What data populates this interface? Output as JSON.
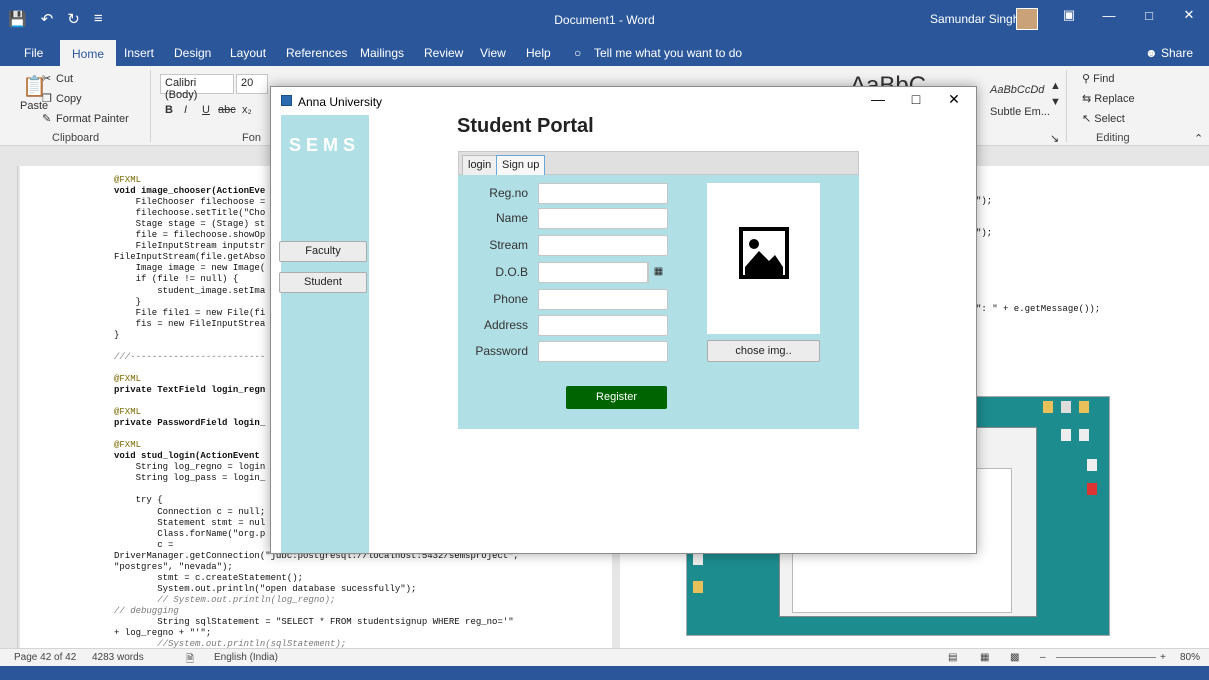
{
  "word": {
    "doc_title": "Document1  -  Word",
    "user": "Samundar Singh",
    "tabs": [
      "File",
      "Home",
      "Insert",
      "Design",
      "Layout",
      "References",
      "Mailings",
      "Review",
      "View",
      "Help"
    ],
    "tell_me": "Tell me what you want to do",
    "share": "Share",
    "clipboard": {
      "paste": "Paste",
      "cut": "Cut",
      "copy": "Copy",
      "format_painter": "Format Painter",
      "group_label": "Clipboard"
    },
    "font": {
      "name": "Calibri (Body)",
      "size": "20",
      "group_label": "Fon"
    },
    "styles": {
      "preview_big": "AaBbC",
      "preview_right": "AaBbCcDd",
      "subtle": "Subtle Em..."
    },
    "editing": {
      "find": "Find",
      "replace": "Replace",
      "select": "Select",
      "group_label": "Editing"
    },
    "status": {
      "page": "Page 42 of 42",
      "words": "4283 words",
      "language": "English (India)",
      "zoom": "80%"
    }
  },
  "code_lines": [
    "@FXML",
    "void image_chooser(ActionEve",
    "    FileChooser filechoose =",
    "    filechoose.setTitle(\"Cho",
    "    Stage stage = (Stage) st",
    "    file = filechoose.showOp",
    "    FileInputStream inputstr",
    "FileInputStream(file.getAbso",
    "    Image image = new Image(",
    "    if (file != null) {",
    "        student_image.setIma",
    "    }",
    "    File file1 = new File(fi",
    "    fis = new FileInputStrea",
    "}",
    "",
    "///-------------------------",
    "",
    "@FXML",
    "private TextField login_regn",
    "",
    "@FXML",
    "private PasswordField login_",
    "",
    "@FXML",
    "void stud_login(ActionEvent",
    "    String log_regno = login",
    "    String log_pass = login_",
    "",
    "    try {",
    "        Connection c = null;",
    "        Statement stmt = nul",
    "        Class.forName(\"org.p",
    "        c =",
    "DriverManager.getConnection(\"jdbc:postgresql://localhost:5432/semsproject\",",
    "\"postgres\", \"nevada\");",
    "        stmt = c.createStatement();",
    "        System.out.println(\"open database sucessfully\");",
    "        // System.out.println(log_regno);",
    "// debugging",
    "        String sqlStatement = \"SELECT * FROM studentsignup WHERE reg_no='\"",
    "+ log_regno + \"'\";",
    "        //System.out.println(sqlStatement);"
  ],
  "page2_fragments": [
    "\");",
    "\");",
    "\": \" + e.getMessage());"
  ],
  "dialog": {
    "title": "Anna University",
    "brand": "SEMS",
    "sidebar_buttons": [
      "Faculty",
      "Student"
    ],
    "portal_title": "Student Portal",
    "tabs": [
      "login",
      "Sign up"
    ],
    "fields": [
      {
        "label": "Reg.no",
        "value": ""
      },
      {
        "label": "Name",
        "value": ""
      },
      {
        "label": "Stream",
        "value": ""
      },
      {
        "label": "D.O.B",
        "value": ""
      },
      {
        "label": "Phone",
        "value": ""
      },
      {
        "label": "Address",
        "value": ""
      },
      {
        "label": "Password",
        "value": ""
      }
    ],
    "register_label": "Register",
    "chose_img_label": "chose img..",
    "colors": {
      "panel": "#b0dfe6",
      "register": "#006400"
    }
  },
  "colors": {
    "word_blue": "#2b579a",
    "desktop": "#1d8c8f"
  }
}
